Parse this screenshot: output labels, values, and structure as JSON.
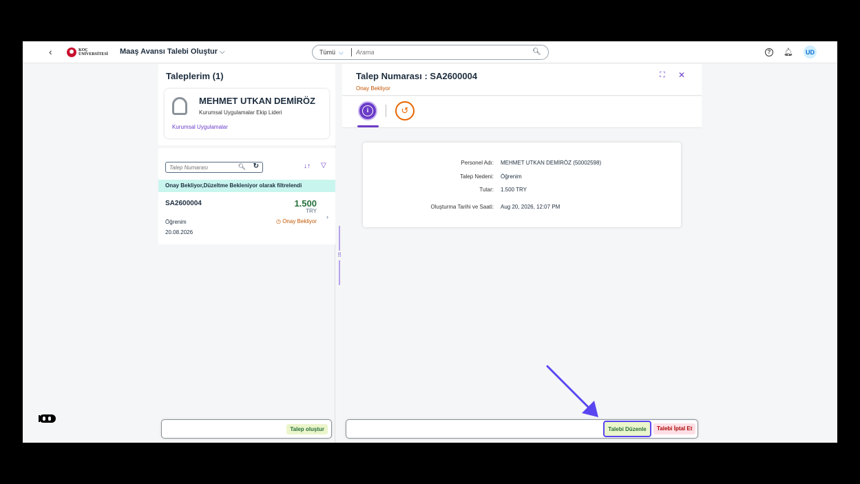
{
  "shell": {
    "back_icon": "chevron-left-icon",
    "logo_line1": "KOÇ",
    "logo_line2": "ÜNİVERSİTESİ",
    "app_title": "Maaş Avansı Talebi Oluştur",
    "search_scope": "Tümü",
    "search_placeholder": "Arama",
    "avatar_initials": "UD"
  },
  "left": {
    "title": "Taleplerim (1)",
    "profile": {
      "name": "MEHMET UTKAN DEMİRÖZ",
      "role": "Kurumsal Uygulamalar Ekip Lideri",
      "department": "Kurumsal Uygulamalar"
    },
    "filter_placeholder": "Talep Numarası",
    "info_bar": "Onay Bekliyor,Düzeltme Bekleniyor olarak filtrelendi",
    "items": [
      {
        "number": "SA2600004",
        "amount": "1.500",
        "currency": "TRY",
        "reason": "Öğrenim",
        "date": "20.08.2026",
        "status": "Onay Bekliyor"
      }
    ],
    "create_button": "Talep oluştur"
  },
  "right": {
    "title": "Talep Numarası : SA2600004",
    "status": "Onay Bekliyor",
    "details": [
      {
        "label": "Personel Adı:",
        "value": "MEHMET UTKAN DEMİRÖZ (50002598)"
      },
      {
        "label": "Talep Nedeni:",
        "value": "Öğrenim"
      },
      {
        "label": "Tutar:",
        "value": "1.500 TRY"
      },
      {
        "label": "Oluşturma Tarihi ve Saati:",
        "value": "Aug 20, 2026, 12:07 PM"
      }
    ],
    "edit_button": "Talebi Düzenle",
    "cancel_button": "Talebi İptal Et"
  },
  "colors": {
    "accent": "#6b3cc8",
    "status_warning": "#c35500",
    "positive": "#256f3a",
    "annotation": "#5a46f0"
  }
}
